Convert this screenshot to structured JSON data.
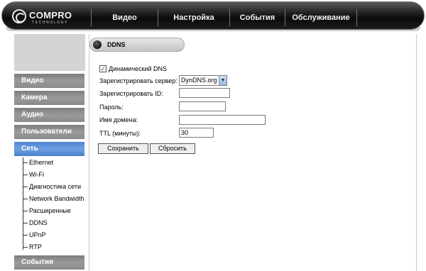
{
  "brand": {
    "name": "COMPRO",
    "tagline": "TECHNOLOGY"
  },
  "nav": [
    {
      "label": "Видео"
    },
    {
      "label": "Настройка"
    },
    {
      "label": "События"
    },
    {
      "label": "Обслуживание"
    }
  ],
  "sidebar": {
    "items": [
      {
        "label": "Видео"
      },
      {
        "label": "Камера"
      },
      {
        "label": "Аудио"
      },
      {
        "label": "Пользователи"
      },
      {
        "label": "Сеть"
      },
      {
        "label": "События"
      }
    ],
    "active": "Сеть",
    "sub_items": [
      {
        "label": "Ethernet"
      },
      {
        "label": "Wi-Fi"
      },
      {
        "label": "Диагностика сети"
      },
      {
        "label": "Network Bandwidth"
      },
      {
        "label": "Расширенные"
      },
      {
        "label": "DDNS"
      },
      {
        "label": "UPnP"
      },
      {
        "label": "RTP"
      }
    ]
  },
  "section": {
    "title": "DDNS"
  },
  "form": {
    "dynamic_dns": {
      "label": "Динамический DNS",
      "checked": true
    },
    "server": {
      "label": "Зарегистрировать сервер:",
      "value": "DynDNS.org"
    },
    "reg_id": {
      "label": "Зарегистрировать ID:",
      "value": ""
    },
    "password": {
      "label": "Пароль:",
      "value": ""
    },
    "domain": {
      "label": "Имя домена:",
      "value": ""
    },
    "ttl": {
      "label": "TTL (минуты):",
      "value": "30"
    },
    "save_label": "Сохранить",
    "reset_label": "Сбросить"
  },
  "colors": {
    "active_sidebar": "#5b8fd8",
    "topbar": "#111111",
    "checkbox_mark": "#0a7a2a"
  }
}
